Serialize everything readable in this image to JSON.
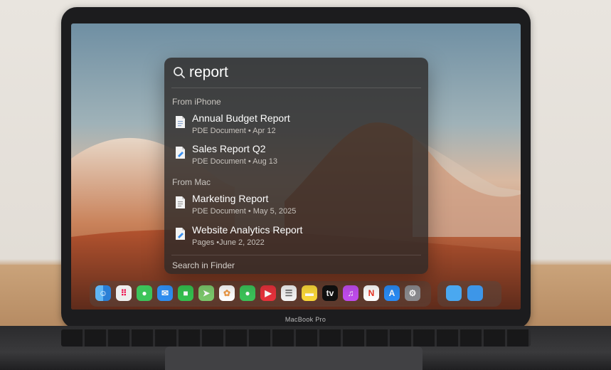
{
  "search": {
    "query": "report"
  },
  "sections": [
    {
      "title": "From iPhone",
      "results": [
        {
          "title": "Annual Budget Report",
          "subtitle": "PDE Document • Apr 12",
          "icon": "document-icon"
        },
        {
          "title": "Sales Report Q2",
          "subtitle": "PDE Document • Aug 13",
          "icon": "pages-document-icon"
        }
      ]
    },
    {
      "title": "From Mac",
      "results": [
        {
          "title": "Marketing Report",
          "subtitle": "PDE Document • May 5, 2025",
          "icon": "document-icon"
        },
        {
          "title": "Website Analytics Report",
          "subtitle": "Pages •June 2, 2022",
          "icon": "pages-document-icon"
        }
      ]
    }
  ],
  "footer": {
    "search_in_finder": "Search in Finder"
  },
  "device": {
    "model_label": "MacBook Pro"
  },
  "dock": {
    "apps": [
      "finder-icon",
      "launchpad-icon",
      "messages-icon",
      "mail-icon",
      "facetime-icon",
      "maps-icon",
      "photos-icon",
      "messages-icon",
      "facetime-video-icon",
      "reminders-icon",
      "notes-icon",
      "apple-tv-icon",
      "music-icon",
      "news-icon",
      "app-store-icon",
      "system-settings-icon"
    ],
    "folders": [
      "folder-icon",
      "downloads-folder-icon"
    ]
  },
  "colors": {
    "accent_blue": "#3b8ff0",
    "panel_bg": "#2d2a28"
  }
}
